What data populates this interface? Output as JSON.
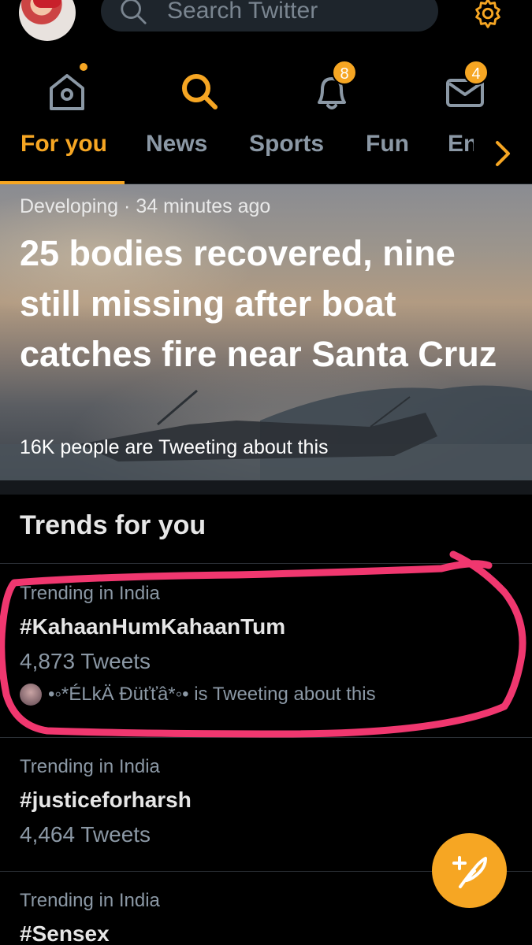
{
  "search": {
    "placeholder": "Search Twitter"
  },
  "nav": {
    "notifications_count": "8",
    "messages_count": "4"
  },
  "tabs": [
    "For you",
    "News",
    "Sports",
    "Fun",
    "En"
  ],
  "hero": {
    "category": "Developing",
    "time": "34 minutes ago",
    "headline": "25 bodies recovered, nine still missing after boat catches fire near Santa Cruz",
    "social": "16K people are Tweeting about this"
  },
  "trends": {
    "header": "Trends for you",
    "items": [
      {
        "context": "Trending in India",
        "name": "#KahaanHumKahaanTum",
        "count": "4,873 Tweets",
        "who": "•◦*ÉLkÄ Ðüťťâ*◦• is Tweeting about this"
      },
      {
        "context": "Trending in India",
        "name": "#justiceforharsh",
        "count": "4,464 Tweets"
      },
      {
        "context": "Trending in India",
        "name": "#Sensex"
      }
    ]
  },
  "colors": {
    "accent": "#f6a623",
    "background": "#000000",
    "highlight": "#f0376f"
  }
}
